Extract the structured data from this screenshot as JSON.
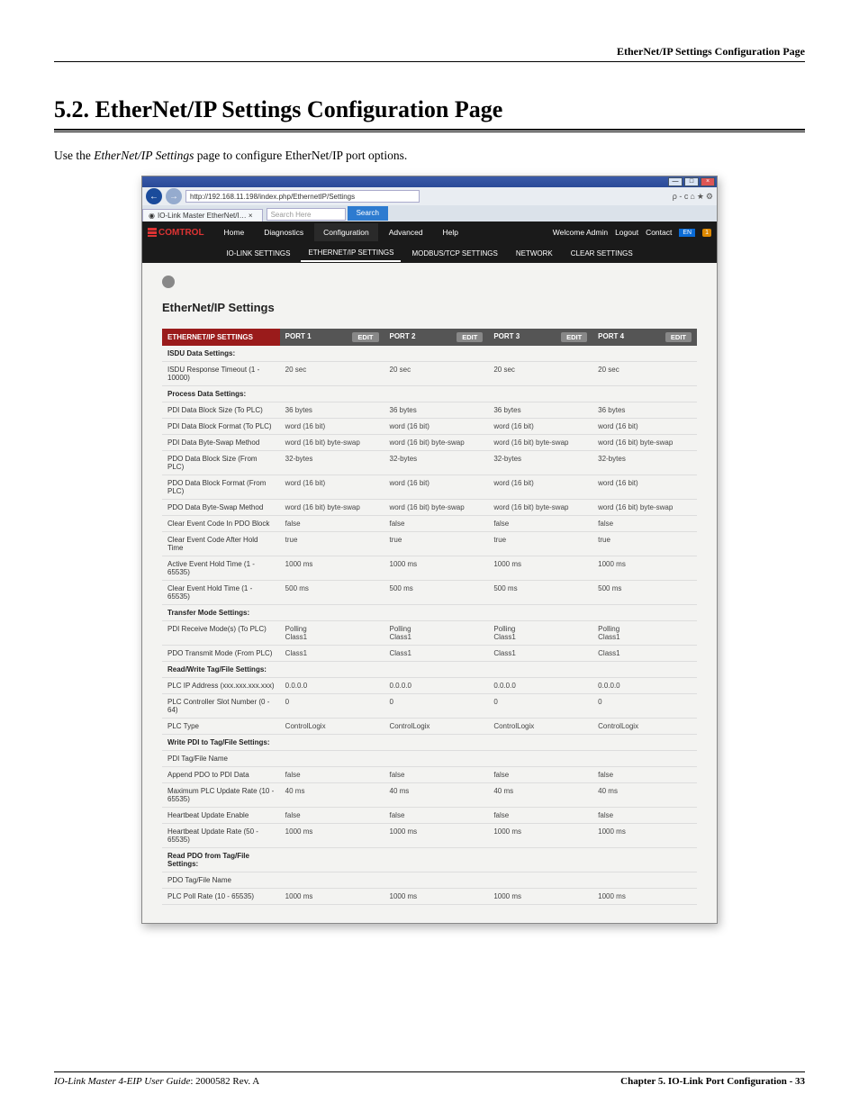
{
  "header": {
    "right": "EtherNet/IP Settings Configuration Page"
  },
  "section": {
    "number": "5.2.",
    "title": "EtherNet/IP Settings Configuration Page",
    "intro_prefix": "Use the ",
    "intro_em": "EtherNet/IP Settings",
    "intro_suffix": " page to configure EtherNet/IP port options."
  },
  "browser": {
    "url": "http://192.168.11.198/index.php/EthernetIP/Settings",
    "tab": "IO-Link Master EtherNet/I… ×",
    "search_placeholder": "Search Here",
    "search_button": "Search",
    "win_url_badge": "ρ - c"
  },
  "topnav": {
    "brand": "COMTROL",
    "items": [
      "Home",
      "Diagnostics",
      "Configuration",
      "Advanced",
      "Help"
    ],
    "active": "Configuration",
    "welcome": "Welcome Admin",
    "logout": "Logout",
    "contact": "Contact",
    "lang": "EN",
    "alert": "1"
  },
  "subnav": {
    "items": [
      "IO-LINK SETTINGS",
      "ETHERNET/IP SETTINGS",
      "MODBUS/TCP SETTINGS",
      "NETWORK",
      "CLEAR SETTINGS"
    ],
    "selected": "ETHERNET/IP SETTINGS"
  },
  "panel_title": "EtherNet/IP Settings",
  "table": {
    "corner": "ETHERNET/IP SETTINGS",
    "ports": [
      "PORT 1",
      "PORT 2",
      "PORT 3",
      "PORT 4"
    ],
    "edit": "EDIT",
    "rows": [
      {
        "section": "ISDU Data Settings:"
      },
      {
        "label": "ISDU Response Timeout (1 - 10000)",
        "v": [
          "20 sec",
          "20 sec",
          "20 sec",
          "20 sec"
        ]
      },
      {
        "section": "Process Data Settings:"
      },
      {
        "label": "PDI Data Block Size (To PLC)",
        "v": [
          "36 bytes",
          "36 bytes",
          "36 bytes",
          "36 bytes"
        ]
      },
      {
        "label": "PDI Data Block Format (To PLC)",
        "v": [
          "word (16 bit)",
          "word (16 bit)",
          "word (16 bit)",
          "word (16 bit)"
        ]
      },
      {
        "label": "PDI Data Byte-Swap Method",
        "v": [
          "word (16 bit) byte-swap",
          "word (16 bit) byte-swap",
          "word (16 bit) byte-swap",
          "word (16 bit) byte-swap"
        ]
      },
      {
        "label": "PDO Data Block Size (From PLC)",
        "v": [
          "32-bytes",
          "32-bytes",
          "32-bytes",
          "32-bytes"
        ]
      },
      {
        "label": "PDO Data Block Format (From PLC)",
        "v": [
          "word (16 bit)",
          "word (16 bit)",
          "word (16 bit)",
          "word (16 bit)"
        ]
      },
      {
        "label": "PDO Data Byte-Swap Method",
        "v": [
          "word (16 bit) byte-swap",
          "word (16 bit) byte-swap",
          "word (16 bit) byte-swap",
          "word (16 bit) byte-swap"
        ]
      },
      {
        "label": "Clear Event Code In PDO Block",
        "v": [
          "false",
          "false",
          "false",
          "false"
        ]
      },
      {
        "label": "Clear Event Code After Hold Time",
        "v": [
          "true",
          "true",
          "true",
          "true"
        ]
      },
      {
        "label": "Active Event Hold Time (1 - 65535)",
        "v": [
          "1000 ms",
          "1000 ms",
          "1000 ms",
          "1000 ms"
        ]
      },
      {
        "label": "Clear Event Hold Time (1 - 65535)",
        "v": [
          "500 ms",
          "500 ms",
          "500 ms",
          "500 ms"
        ]
      },
      {
        "section": "Transfer Mode Settings:"
      },
      {
        "label": "PDI Receive Mode(s) (To PLC)",
        "v": [
          "Polling\nClass1",
          "Polling\nClass1",
          "Polling\nClass1",
          "Polling\nClass1"
        ]
      },
      {
        "label": "PDO Transmit Mode (From PLC)",
        "v": [
          "Class1",
          "Class1",
          "Class1",
          "Class1"
        ]
      },
      {
        "section": "Read/Write Tag/File Settings:"
      },
      {
        "label": "PLC IP Address (xxx.xxx.xxx.xxx)",
        "v": [
          "0.0.0.0",
          "0.0.0.0",
          "0.0.0.0",
          "0.0.0.0"
        ]
      },
      {
        "label": "PLC Controller Slot Number (0 - 64)",
        "v": [
          "0",
          "0",
          "0",
          "0"
        ]
      },
      {
        "label": "PLC Type",
        "v": [
          "ControlLogix",
          "ControlLogix",
          "ControlLogix",
          "ControlLogix"
        ]
      },
      {
        "section": "Write PDI to Tag/File Settings:"
      },
      {
        "label": "PDI Tag/File Name",
        "v": [
          "",
          "",
          "",
          ""
        ]
      },
      {
        "label": "Append PDO to PDI Data",
        "v": [
          "false",
          "false",
          "false",
          "false"
        ]
      },
      {
        "label": "Maximum PLC Update Rate (10 - 65535)",
        "v": [
          "40 ms",
          "40 ms",
          "40 ms",
          "40 ms"
        ]
      },
      {
        "label": "Heartbeat Update Enable",
        "v": [
          "false",
          "false",
          "false",
          "false"
        ]
      },
      {
        "label": "Heartbeat Update Rate (50 - 65535)",
        "v": [
          "1000 ms",
          "1000 ms",
          "1000 ms",
          "1000 ms"
        ]
      },
      {
        "section": "Read PDO from Tag/File Settings:"
      },
      {
        "label": "PDO Tag/File Name",
        "v": [
          "",
          "",
          "",
          ""
        ]
      },
      {
        "label": "PLC Poll Rate (10 - 65535)",
        "v": [
          "1000 ms",
          "1000 ms",
          "1000 ms",
          "1000 ms"
        ]
      }
    ]
  },
  "footer": {
    "left_italic": "IO-Link Master 4-EIP User Guide",
    "left_rev": ": 2000582 Rev. A",
    "right": "Chapter 5. IO-Link Port Configuration  - 33"
  }
}
